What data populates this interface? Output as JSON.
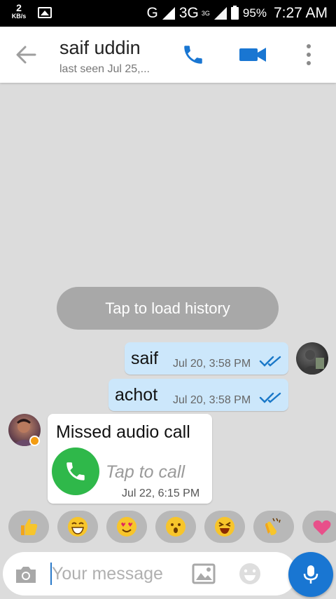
{
  "status_bar": {
    "speed_value": "2",
    "speed_unit": "KB/s",
    "net1": "G",
    "net2": "3G",
    "net2_sup": "3G",
    "battery": "95%",
    "time": "7:27 AM"
  },
  "toolbar": {
    "title": "saif uddin",
    "subtitle": "last seen Jul 25,..."
  },
  "chat": {
    "load_history": "Tap to load history",
    "messages_out": [
      {
        "text": "saif",
        "time": "Jul 20, 3:58 PM"
      },
      {
        "text": "achot",
        "time": "Jul 20, 3:58 PM"
      }
    ],
    "call_card": {
      "title": "Missed audio call",
      "action": "Tap to call",
      "time": "Jul 22, 6:15 PM"
    }
  },
  "quick_reactions": [
    "thumbs-up",
    "grinning-tears",
    "heart-eyes",
    "surprised",
    "laughing",
    "clapping-hands",
    "heart"
  ],
  "composer": {
    "placeholder": "Your message"
  },
  "colors": {
    "accent": "#1976d2",
    "outgoing_bubble": "#cce7fb",
    "call_green": "#2fb84a"
  }
}
